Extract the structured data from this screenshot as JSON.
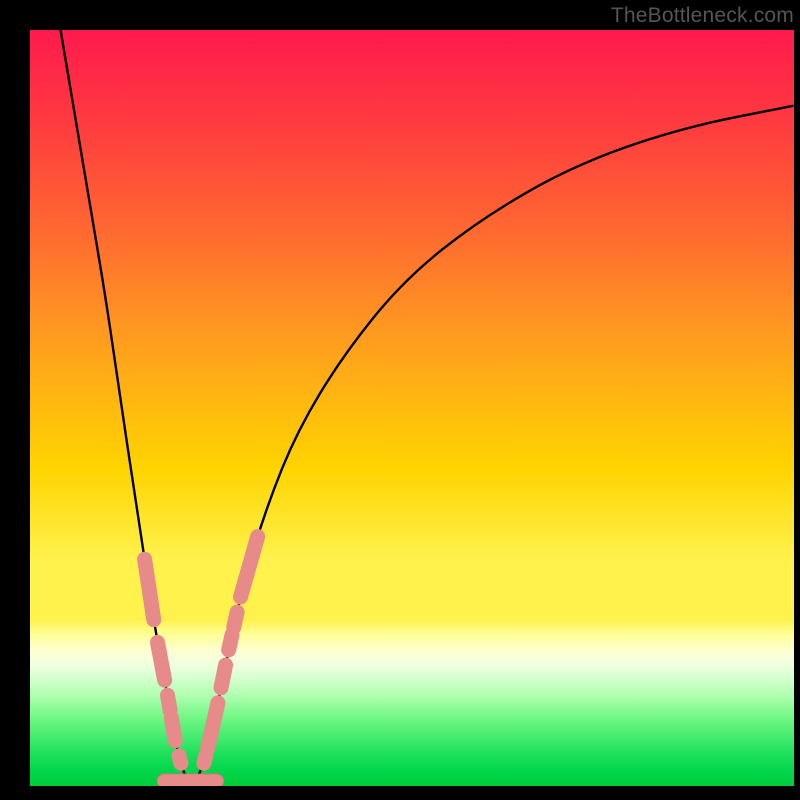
{
  "watermark": "TheBottleneck.com",
  "colors": {
    "marker_fill": "#e78a8a",
    "marker_stroke": "#d87575",
    "curve": "#000000"
  },
  "chart_data": {
    "type": "line",
    "title": "",
    "xlabel": "",
    "ylabel": "",
    "xlim": [
      0,
      100
    ],
    "ylim": [
      0,
      100
    ],
    "x_optimum_pct": 21,
    "left_branch": [
      {
        "x": 4,
        "y": 100
      },
      {
        "x": 6,
        "y": 88
      },
      {
        "x": 8,
        "y": 76
      },
      {
        "x": 10,
        "y": 64
      },
      {
        "x": 12,
        "y": 50
      },
      {
        "x": 13.5,
        "y": 40
      },
      {
        "x": 15,
        "y": 30
      },
      {
        "x": 16.5,
        "y": 20
      },
      {
        "x": 18,
        "y": 12
      },
      {
        "x": 19,
        "y": 6
      },
      {
        "x": 20,
        "y": 2
      },
      {
        "x": 21,
        "y": 0
      }
    ],
    "right_branch": [
      {
        "x": 21,
        "y": 0
      },
      {
        "x": 22.5,
        "y": 2
      },
      {
        "x": 24,
        "y": 8
      },
      {
        "x": 26,
        "y": 18
      },
      {
        "x": 28,
        "y": 27
      },
      {
        "x": 31,
        "y": 37
      },
      {
        "x": 35,
        "y": 47
      },
      {
        "x": 41,
        "y": 57
      },
      {
        "x": 49,
        "y": 67
      },
      {
        "x": 59,
        "y": 75
      },
      {
        "x": 71,
        "y": 82
      },
      {
        "x": 85,
        "y": 87
      },
      {
        "x": 100,
        "y": 90
      }
    ],
    "marker_segments": [
      {
        "side": "left",
        "y_start": 30,
        "y_end": 22,
        "shape": "capsule"
      },
      {
        "side": "left",
        "y_start": 19,
        "y_end": 14,
        "shape": "capsule"
      },
      {
        "side": "left",
        "y_start": 12,
        "y_end": 10,
        "shape": "dot"
      },
      {
        "side": "left",
        "y_start": 9,
        "y_end": 6,
        "shape": "capsule"
      },
      {
        "side": "left",
        "y_start": 4,
        "y_end": 3,
        "shape": "dot"
      },
      {
        "side": "trough",
        "y_start": 1,
        "y_end": 1,
        "shape": "bar"
      },
      {
        "side": "right",
        "y_start": 3,
        "y_end": 4,
        "shape": "dot"
      },
      {
        "side": "right",
        "y_start": 5,
        "y_end": 11,
        "shape": "capsule"
      },
      {
        "side": "right",
        "y_start": 13,
        "y_end": 16,
        "shape": "capsule"
      },
      {
        "side": "right",
        "y_start": 18,
        "y_end": 20,
        "shape": "dot"
      },
      {
        "side": "right",
        "y_start": 21,
        "y_end": 23,
        "shape": "dot"
      },
      {
        "side": "right",
        "y_start": 25,
        "y_end": 33,
        "shape": "capsule"
      }
    ]
  }
}
